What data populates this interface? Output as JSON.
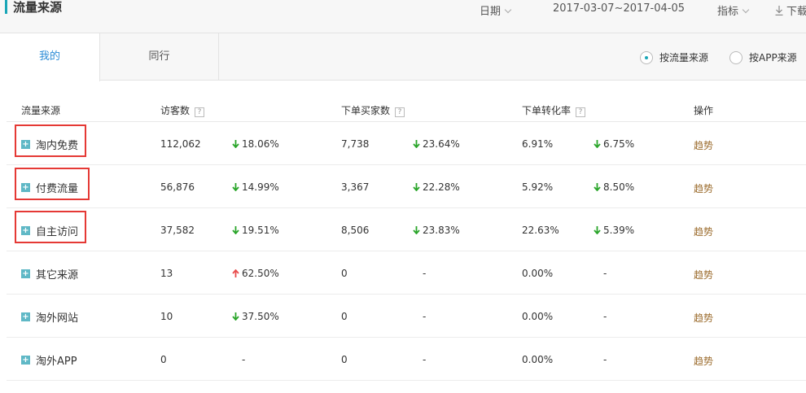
{
  "header": {
    "title": "流量来源",
    "date_label": "日期",
    "date_range": "2017-03-07~2017-04-05",
    "metric_label": "指标",
    "download_label": "下载"
  },
  "tabs": [
    {
      "label": "我的",
      "active": true
    },
    {
      "label": "同行",
      "active": false
    }
  ],
  "view_options": [
    {
      "label": "按流量来源",
      "selected": true
    },
    {
      "label": "按APP来源",
      "selected": false
    }
  ],
  "table": {
    "columns": [
      "流量来源",
      "访客数",
      "下单买家数",
      "下单转化率",
      "操作"
    ],
    "rows": [
      {
        "source": "淘内免费",
        "visitors": "112,062",
        "visitors_change": "18.06%",
        "visitors_dir": "down",
        "buyers": "7,738",
        "buyers_change": "23.64%",
        "buyers_dir": "down",
        "conv": "6.91%",
        "conv_change": "6.75%",
        "conv_dir": "down",
        "action": "趋势",
        "highlighted": true
      },
      {
        "source": "付费流量",
        "visitors": "56,876",
        "visitors_change": "14.99%",
        "visitors_dir": "down",
        "buyers": "3,367",
        "buyers_change": "22.28%",
        "buyers_dir": "down",
        "conv": "5.92%",
        "conv_change": "8.50%",
        "conv_dir": "down",
        "action": "趋势",
        "highlighted": true
      },
      {
        "source": "自主访问",
        "visitors": "37,582",
        "visitors_change": "19.51%",
        "visitors_dir": "down",
        "buyers": "8,506",
        "buyers_change": "23.83%",
        "buyers_dir": "down",
        "conv": "22.63%",
        "conv_change": "5.39%",
        "conv_dir": "down",
        "action": "趋势",
        "highlighted": true
      },
      {
        "source": "其它来源",
        "visitors": "13",
        "visitors_change": "62.50%",
        "visitors_dir": "up",
        "buyers": "0",
        "buyers_change": "-",
        "buyers_dir": "none",
        "conv": "0.00%",
        "conv_change": "-",
        "conv_dir": "none",
        "action": "趋势",
        "highlighted": false
      },
      {
        "source": "淘外网站",
        "visitors": "10",
        "visitors_change": "37.50%",
        "visitors_dir": "down",
        "buyers": "0",
        "buyers_change": "-",
        "buyers_dir": "none",
        "conv": "0.00%",
        "conv_change": "-",
        "conv_dir": "none",
        "action": "趋势",
        "highlighted": false
      },
      {
        "source": "淘外APP",
        "visitors": "0",
        "visitors_change": "-",
        "visitors_dir": "none",
        "buyers": "0",
        "buyers_change": "-",
        "buyers_dir": "none",
        "conv": "0.00%",
        "conv_change": "-",
        "conv_dir": "none",
        "action": "趋势",
        "highlighted": false
      }
    ]
  },
  "colors": {
    "accent": "#1aa6b7",
    "down_arrow": "#2aa52a",
    "up_arrow": "#e84c4c",
    "highlight_box": "#e53935",
    "active_tab": "#2b8bd6",
    "trend_link": "#9b6b2c"
  },
  "icons": {
    "expand": "plus-icon",
    "decrease": "arrow-down-icon",
    "increase": "arrow-up-icon",
    "download": "download-icon",
    "help": "question-icon"
  }
}
